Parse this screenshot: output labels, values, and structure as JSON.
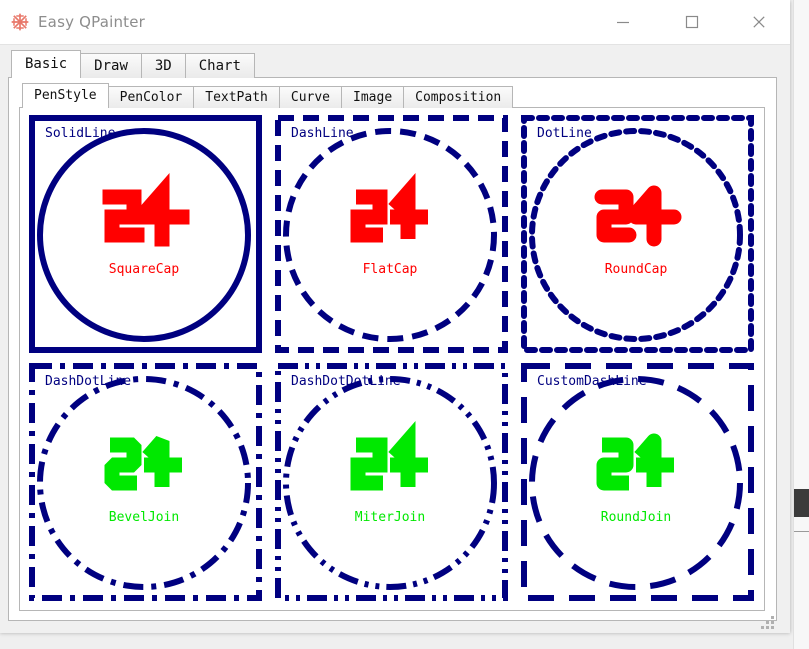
{
  "window": {
    "title": "Easy QPainter",
    "icon": "snowflake-icon",
    "icon_color": "#e8786a",
    "controls": {
      "minimize": "minimize-icon",
      "maximize": "maximize-icon",
      "close": "close-icon"
    }
  },
  "outer_tabs": {
    "active": "Basic",
    "items": [
      {
        "label": "Basic"
      },
      {
        "label": "Draw"
      },
      {
        "label": "3D"
      },
      {
        "label": "Chart"
      }
    ]
  },
  "inner_tabs": {
    "active": "PenStyle",
    "items": [
      {
        "label": "PenStyle"
      },
      {
        "label": "PenColor"
      },
      {
        "label": "TextPath"
      },
      {
        "label": "Curve"
      },
      {
        "label": "Image"
      },
      {
        "label": "Composition"
      }
    ]
  },
  "colors": {
    "pen": "#000080",
    "glyph_red": "#ff0000",
    "glyph_green": "#00e800",
    "panel": "#ffffff",
    "window_bg": "#f0f0f0"
  },
  "pen_demo_cells": [
    {
      "style_label": "SolidLine",
      "attribute_label": "SquareCap",
      "glyph": "2牛",
      "glyph_color": "#ff0000",
      "dash_pattern": "none",
      "cap": "square",
      "join": "miter"
    },
    {
      "style_label": "DashLine",
      "attribute_label": "FlatCap",
      "glyph": "2牛",
      "glyph_color": "#ff0000",
      "dash_pattern": "16,9",
      "cap": "butt",
      "join": "miter"
    },
    {
      "style_label": "DotLine",
      "attribute_label": "RoundCap",
      "glyph": "2牛",
      "glyph_color": "#ff0000",
      "dash_pattern": "8,7",
      "cap": "round",
      "join": "round"
    },
    {
      "style_label": "DashDotLine",
      "attribute_label": "BevelJoin",
      "glyph": "2牛",
      "glyph_color": "#00e800",
      "dash_pattern": "20,8,5,8",
      "cap": "butt",
      "join": "bevel"
    },
    {
      "style_label": "DashDotDotLine",
      "attribute_label": "MiterJoin",
      "glyph": "2牛",
      "glyph_color": "#00e800",
      "dash_pattern": "20,7,4,7,4,7",
      "cap": "butt",
      "join": "miter"
    },
    {
      "style_label": "CustomDashLine",
      "attribute_label": "RoundJoin",
      "glyph": "2牛",
      "glyph_color": "#00e800",
      "dash_pattern": "26,15",
      "cap": "butt",
      "join": "round"
    }
  ]
}
